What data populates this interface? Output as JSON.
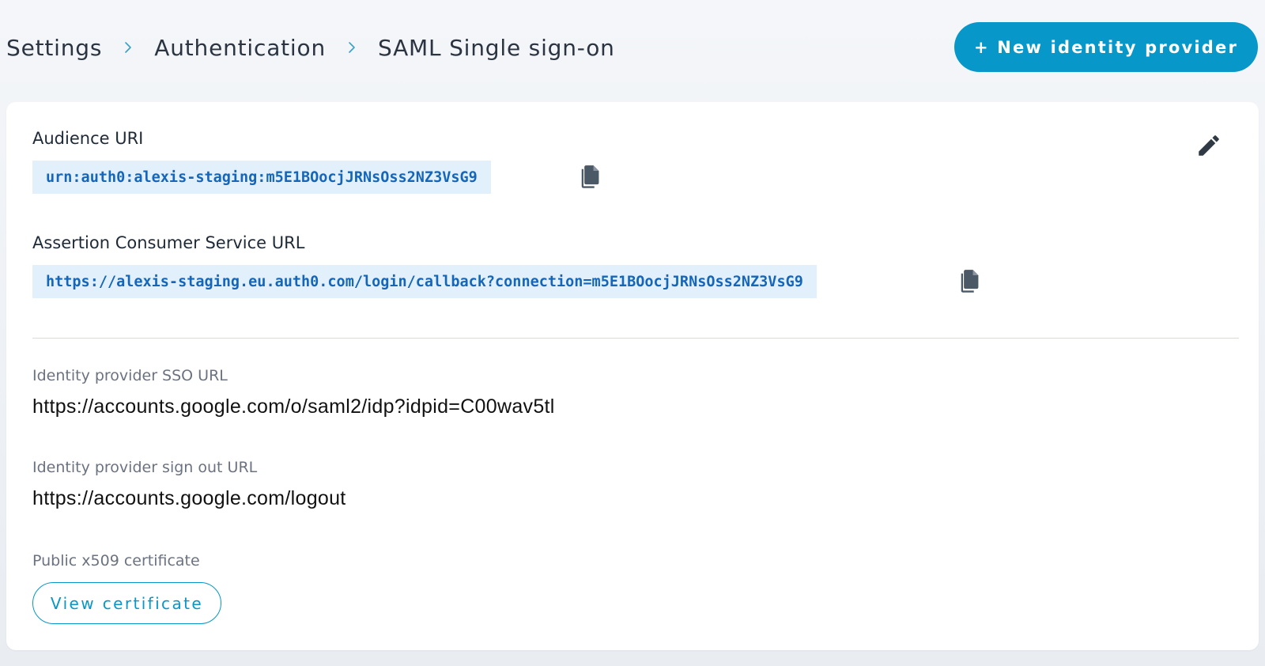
{
  "breadcrumb": {
    "items": [
      {
        "label": "Settings"
      },
      {
        "label": "Authentication"
      },
      {
        "label": "SAML Single sign-on"
      }
    ]
  },
  "header": {
    "new_idp_label": "+ New identity provider"
  },
  "card": {
    "audience": {
      "label": "Audience URI",
      "value": "urn:auth0:alexis-staging:m5E1BOocjJRNsOss2NZ3VsG9"
    },
    "acs": {
      "label": "Assertion Consumer Service URL",
      "value": "https://alexis-staging.eu.auth0.com/login/callback?connection=m5E1BOocjJRNsOss2NZ3VsG9"
    },
    "sso_url": {
      "label": "Identity provider SSO URL",
      "value": "https://accounts.google.com/o/saml2/idp?idpid=C00wav5tl"
    },
    "signout_url": {
      "label": "Identity provider sign out URL",
      "value": "https://accounts.google.com/logout"
    },
    "certificate": {
      "label": "Public x509 certificate",
      "button_label": "View certificate"
    }
  },
  "icons": {
    "breadcrumb_separator": "chevron-right-icon",
    "edit": "pencil-icon",
    "copy": "copy-icon"
  },
  "colors": {
    "accent": "#0797c8",
    "code_background": "#e2f0fb",
    "code_text": "#1566b8"
  }
}
